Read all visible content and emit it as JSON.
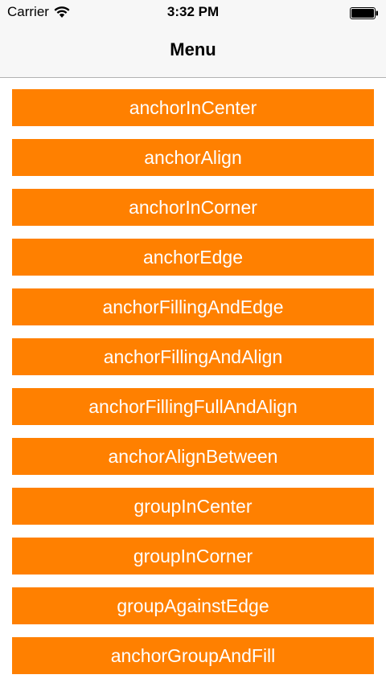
{
  "status_bar": {
    "carrier": "Carrier",
    "time": "3:32 PM",
    "wifi_icon": "wifi-icon",
    "battery_icon": "battery-icon"
  },
  "nav": {
    "title": "Menu"
  },
  "colors": {
    "button_background": "#ff8000",
    "button_text": "#ffffff"
  },
  "menu": {
    "items": [
      {
        "label": "anchorInCenter"
      },
      {
        "label": "anchorAlign"
      },
      {
        "label": "anchorInCorner"
      },
      {
        "label": "anchorEdge"
      },
      {
        "label": "anchorFillingAndEdge"
      },
      {
        "label": "anchorFillingAndAlign"
      },
      {
        "label": "anchorFillingFullAndAlign"
      },
      {
        "label": "anchorAlignBetween"
      },
      {
        "label": "groupInCenter"
      },
      {
        "label": "groupInCorner"
      },
      {
        "label": "groupAgainstEdge"
      },
      {
        "label": "anchorGroupAndFill"
      }
    ]
  }
}
